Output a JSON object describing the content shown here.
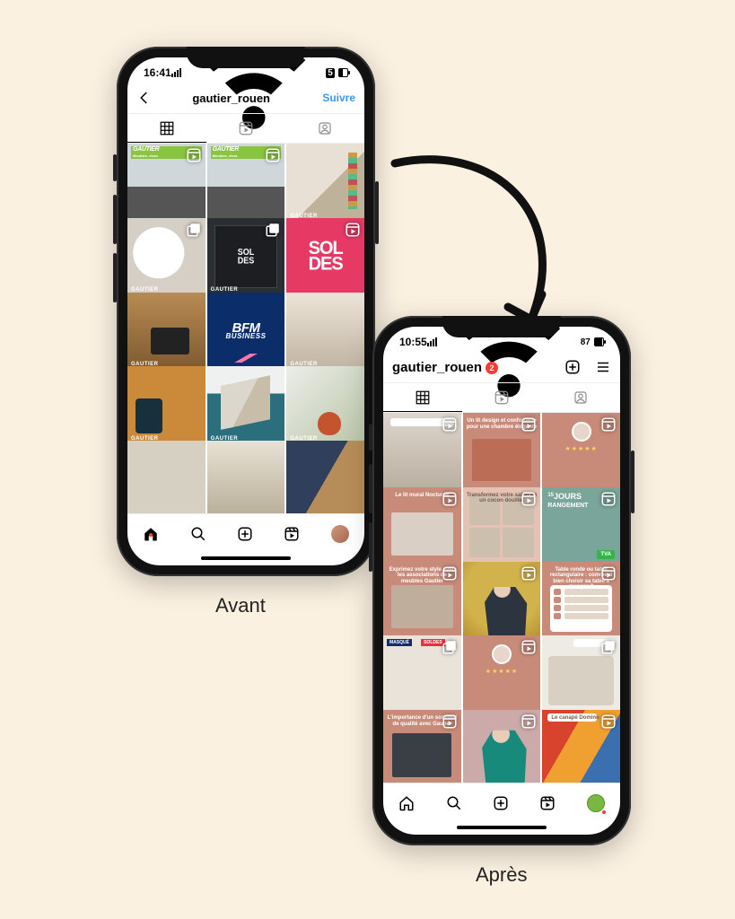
{
  "labels": {
    "before": "Avant",
    "after": "Après"
  },
  "phone_a": {
    "status": {
      "time": "16:41",
      "battery_pct": 50,
      "battery_label": "5"
    },
    "header": {
      "username": "gautier_rouen",
      "follow": "Suivre"
    },
    "tabs": {
      "grid": "grid-icon",
      "reels": "reels-icon",
      "tagged": "tagged-icon",
      "active": "grid"
    },
    "posts": [
      {
        "id": "a1",
        "type": "reel",
        "logo": "GAUTIER",
        "sub": "Meubles. vivez"
      },
      {
        "id": "a2",
        "type": "reel",
        "logo": "GAUTIER",
        "sub": "Meubles. vivez"
      },
      {
        "id": "a3",
        "type": "photo",
        "brand": "GAUTIER"
      },
      {
        "id": "a4",
        "type": "carousel",
        "brand": "GAUTIER"
      },
      {
        "id": "a5",
        "type": "carousel",
        "text": "SOL\nDES",
        "brand": "GAUTIER"
      },
      {
        "id": "a6",
        "type": "reel",
        "text": "SOL\nDES"
      },
      {
        "id": "a7",
        "type": "photo",
        "brand": "GAUTIER"
      },
      {
        "id": "a8",
        "type": "photo",
        "text": "BFM",
        "text2": "BUSINESS"
      },
      {
        "id": "a9",
        "type": "photo",
        "brand": "GAUTIER"
      },
      {
        "id": "a10",
        "type": "photo",
        "brand": "GAUTIER"
      },
      {
        "id": "a11",
        "type": "photo",
        "brand": "GAUTIER"
      },
      {
        "id": "a12",
        "type": "photo",
        "brand": "GAUTIER"
      },
      {
        "id": "a13",
        "type": "photo"
      },
      {
        "id": "a14",
        "type": "photo"
      },
      {
        "id": "a15",
        "type": "photo"
      }
    ],
    "nav": [
      "home",
      "search",
      "create",
      "reels",
      "profile"
    ]
  },
  "phone_b": {
    "status": {
      "time": "10:55",
      "battery_pct": 87,
      "battery_label": "87"
    },
    "header": {
      "username": "gautier_rouen",
      "badge": "2"
    },
    "tabs": {
      "grid": "grid-icon",
      "reels": "reels-icon",
      "tagged": "tagged-icon",
      "active": "grid"
    },
    "posts": [
      {
        "id": "b1",
        "type": "reel"
      },
      {
        "id": "b2",
        "type": "reel",
        "title": "Un lit design et confortable pour une chambre élégante"
      },
      {
        "id": "b3",
        "type": "reel",
        "stars": "★★★★★"
      },
      {
        "id": "b4",
        "type": "reel",
        "title": "Le lit mural Nocturne"
      },
      {
        "id": "b5",
        "type": "reel",
        "title": "Transformez votre salon en un cocon douillet"
      },
      {
        "id": "b6",
        "type": "reel",
        "title_pre": "15",
        "title": "JOURS",
        "title2": "RANGEMENT",
        "badge": "TVA"
      },
      {
        "id": "b7",
        "type": "reel",
        "title": "Exprimez votre style avec les associations de meubles Gautier"
      },
      {
        "id": "b8",
        "type": "reel"
      },
      {
        "id": "b9",
        "type": "reel",
        "title": "Table ronde ou table rectangulaire : comment bien choisir sa table à manger ?"
      },
      {
        "id": "b10",
        "type": "carousel",
        "badge1": "MASQUÉ",
        "badge2": "SOLDES"
      },
      {
        "id": "b11",
        "type": "reel",
        "stars": "★★★★★"
      },
      {
        "id": "b12",
        "type": "carousel"
      },
      {
        "id": "b13",
        "type": "reel",
        "title": "L'importance d'un sommeil de qualité avec Gautier"
      },
      {
        "id": "b14",
        "type": "reel"
      },
      {
        "id": "b15",
        "type": "reel",
        "title": "Le canapé Domino"
      }
    ],
    "nav": [
      "home",
      "search",
      "create",
      "reels",
      "profile"
    ]
  }
}
